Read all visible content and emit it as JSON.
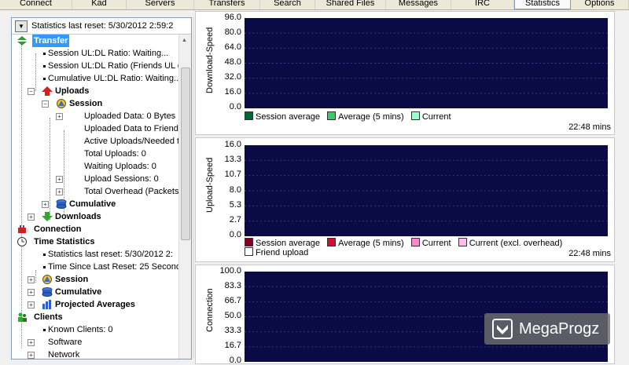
{
  "toolbar": {
    "items": [
      {
        "label": "Connect",
        "w": 92
      },
      {
        "label": "Kad",
        "w": 69
      },
      {
        "label": "Servers",
        "w": 86
      },
      {
        "label": "Transfers",
        "w": 84
      },
      {
        "label": "Search",
        "w": 70
      },
      {
        "label": "Shared Files",
        "w": 90
      },
      {
        "label": "Messages",
        "w": 83
      },
      {
        "label": "IRC",
        "w": 80
      },
      {
        "label": "Statistics",
        "w": 72
      },
      {
        "label": "Options",
        "w": 74
      }
    ]
  },
  "left": {
    "header": "Statistics last reset: 5/30/2012 2:59:2"
  },
  "tree": {
    "transfer": "Transfer",
    "session_ul_dl": "Session UL:DL Ratio: Waiting...",
    "session_ul_dl_friends": "Session UL:DL Ratio (Friends UL e",
    "cumulative_ul_dl": "Cumulative UL:DL Ratio: Waiting...",
    "uploads": "Uploads",
    "session": "Session",
    "uploaded_data": "Uploaded Data: 0 Bytes",
    "uploaded_friend": "Uploaded Data to Friend S",
    "active_uploads": "Active Uploads/Needed to",
    "total_uploads": "Total Uploads: 0",
    "waiting_uploads": "Waiting Uploads: 0",
    "upload_sessions": "Upload Sessions: 0",
    "total_overhead": "Total Overhead (Packets)",
    "cumulative": "Cumulative",
    "downloads": "Downloads",
    "connection": "Connection",
    "time_statistics": "Time Statistics",
    "stats_last_reset": "Statistics last reset: 5/30/2012 2:",
    "time_since_reset": "Time Since Last Reset: 25 Second",
    "ts_session": "Session",
    "ts_cumulative": "Cumulative",
    "projected_averages": "Projected Averages",
    "clients": "Clients",
    "known_clients": "Known Clients: 0",
    "software": "Software",
    "network": "Network"
  },
  "charts": {
    "download": {
      "ylabel": "Download-Speed",
      "ticks": [
        "96.0",
        "80.0",
        "64.0",
        "48.0",
        "32.0",
        "16.0",
        "0.0"
      ],
      "legend": [
        {
          "label": "Session average",
          "color": "#006633"
        },
        {
          "label": "Average (5 mins)",
          "color": "#33cc66"
        },
        {
          "label": "Current",
          "color": "#99ffcc"
        }
      ],
      "time": "22:48 mins"
    },
    "upload": {
      "ylabel": "Upload-Speed",
      "ticks": [
        "16.0",
        "13.3",
        "10.7",
        "8.0",
        "5.3",
        "2.7",
        "0.0"
      ],
      "legend": [
        {
          "label": "Session average",
          "color": "#800020"
        },
        {
          "label": "Average (5 mins)",
          "color": "#cc1133"
        },
        {
          "label": "Current",
          "color": "#ff88cc"
        },
        {
          "label": "Current (excl. overhead)",
          "color": "#ffbbee"
        },
        {
          "label": "Friend upload",
          "color": "#ffffff"
        }
      ],
      "time": "22:48 mins"
    },
    "connection": {
      "ylabel": "Connection",
      "ticks": [
        "100.0",
        "83.3",
        "66.7",
        "50.0",
        "33.3",
        "16.7",
        "0.0"
      ]
    }
  },
  "watermark": {
    "text": "MegaProgz"
  },
  "colors": {
    "plot_bg": "#0a0a45",
    "grid": "#2b3a8a",
    "selection": "#3399ff"
  }
}
